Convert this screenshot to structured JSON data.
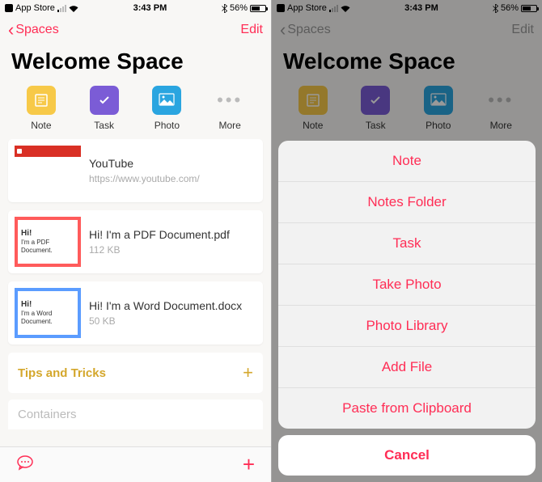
{
  "status": {
    "carrier": "App Store",
    "time": "3:43 PM",
    "battery_pct": "56%"
  },
  "nav": {
    "back": "Spaces",
    "edit": "Edit"
  },
  "title": "Welcome Space",
  "quick": {
    "note": "Note",
    "task": "Task",
    "photo": "Photo",
    "more": "More"
  },
  "cards": {
    "youtube": {
      "title": "YouTube",
      "sub": "https://www.youtube.com/"
    },
    "pdf": {
      "thumb_hi": "Hi!",
      "thumb_line": "I'm a PDF Document.",
      "title": "Hi! I'm a PDF Document.pdf",
      "sub": "112 KB"
    },
    "word": {
      "thumb_hi": "Hi!",
      "thumb_line": "I'm a Word Document.",
      "title": "Hi! I'm a Word Document.docx",
      "sub": "50 KB"
    }
  },
  "tips": "Tips and Tricks",
  "containers": "Containers",
  "sheet": {
    "items": [
      "Note",
      "Notes Folder",
      "Task",
      "Take Photo",
      "Photo Library",
      "Add File",
      "Paste from Clipboard"
    ],
    "cancel": "Cancel"
  }
}
